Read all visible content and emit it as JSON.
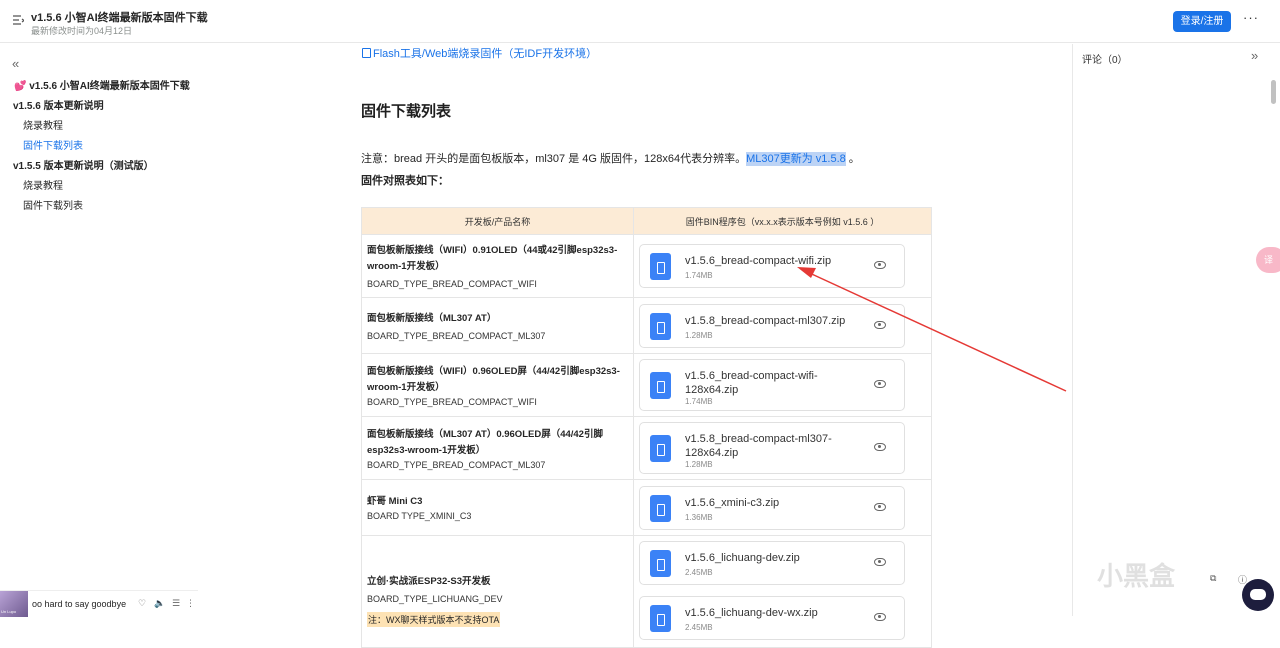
{
  "header": {
    "title": "v1.5.6 小智AI终端最新版本固件下载",
    "subtitle": "最新修改时间为04月12日",
    "login_label": "登录/注册",
    "more_label": "···"
  },
  "sidebar": {
    "items": [
      {
        "label": "💕 v1.5.6 小智AI终端最新版本固件下载",
        "level": 1,
        "active": false
      },
      {
        "label": "v1.5.6 版本更新说明",
        "level": 1,
        "active": false
      },
      {
        "label": "烧录教程",
        "level": 2,
        "active": false
      },
      {
        "label": "固件下载列表",
        "level": 2,
        "active": true
      },
      {
        "label": "v1.5.5 版本更新说明（测试版）",
        "level": 1,
        "active": false
      },
      {
        "label": "烧录教程",
        "level": 2,
        "active": false
      },
      {
        "label": "固件下载列表",
        "level": 2,
        "active": false
      }
    ]
  },
  "content": {
    "flash_link": "Flash工具/Web端烧录固件（无IDF开发环境）",
    "heading": "固件下载列表",
    "note_prefix": "注意：bread 开头的是面包板版本，ml307 是 4G 版固件，128x64代表分辨率。",
    "note_highlight": "ML307更新为 v1.5.8",
    "note_suffix": " 。",
    "compare_label": "固件对照表如下：",
    "table": {
      "headers": [
        "开发板/产品名称",
        "固件BIN程序包（vx.x.x表示版本号例如 v1.5.6 ）"
      ],
      "rows": [
        {
          "name": "面包板新版接线（WIFI）0.91OLED（44或42引脚esp32s3-wroom-1开发板）",
          "type": "BOARD_TYPE_BREAD_COMPACT_WIFI",
          "warn": "",
          "files": [
            {
              "name": "v1.5.6_bread-compact-wifi.zip",
              "size": "1.74MB"
            }
          ]
        },
        {
          "name": "面包板新版接线（ML307 AT）",
          "type": "BOARD_TYPE_BREAD_COMPACT_ML307",
          "warn": "",
          "files": [
            {
              "name": "v1.5.8_bread-compact-ml307.zip",
              "size": "1.28MB"
            }
          ]
        },
        {
          "name": "面包板新版接线（WIFI）0.96OLED屏（44/42引脚esp32s3-wroom-1开发板）",
          "type": "BOARD_TYPE_BREAD_COMPACT_WIFI",
          "warn": "",
          "files": [
            {
              "name": "v1.5.6_bread-compact-wifi-128x64.zip",
              "size": "1.74MB"
            }
          ]
        },
        {
          "name": "面包板新版接线（ML307 AT）0.96OLED屏（44/42引脚esp32s3-wroom-1开发板）",
          "type": "BOARD_TYPE_BREAD_COMPACT_ML307",
          "warn": "",
          "files": [
            {
              "name": "v1.5.8_bread-compact-ml307-128x64.zip",
              "size": "1.28MB"
            }
          ]
        },
        {
          "name": "虾哥 Mini C3",
          "type": "BOARD TYPE_XMINI_C3",
          "warn": "",
          "files": [
            {
              "name": "v1.5.6_xmini-c3.zip",
              "size": "1.36MB"
            }
          ]
        },
        {
          "name": "立创·实战派ESP32-S3开发板",
          "type": "BOARD_TYPE_LICHUANG_DEV",
          "warn": "注：WX聊天样式版本不支持OTA",
          "files": [
            {
              "name": "v1.5.6_lichuang-dev.zip",
              "size": "2.45MB"
            },
            {
              "name": "v1.5.6_lichuang-dev-wx.zip",
              "size": "2.45MB"
            }
          ]
        }
      ]
    }
  },
  "right_panel": {
    "comments_label": "评论（0）",
    "translate_label": "译"
  },
  "player": {
    "song": "oo hard to say goodbye",
    "cover_text": "Un Lupo"
  },
  "watermark": "小黑盒",
  "colors": {
    "accent": "#1a73e8",
    "table_header": "#fcebd6",
    "arrow": "#e53935"
  }
}
